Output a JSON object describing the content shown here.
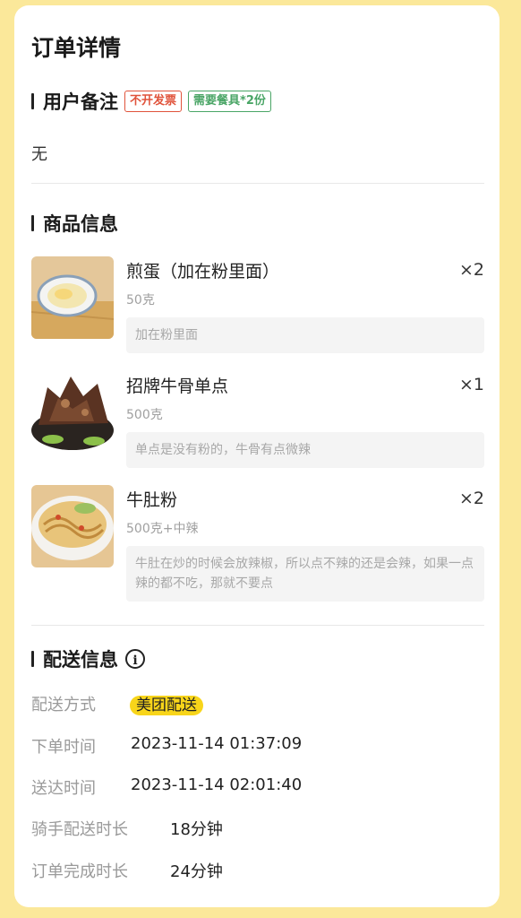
{
  "page": {
    "title": "订单详情"
  },
  "user_note": {
    "heading": "用户备注",
    "tags": [
      {
        "label": "不开发票",
        "color": "#e0533b"
      },
      {
        "label": "需要餐具*2份",
        "color": "#4aa566"
      }
    ],
    "text": "无"
  },
  "goods": {
    "heading": "商品信息",
    "items": [
      {
        "name": "煎蛋（加在粉里面）",
        "qty": "×2",
        "spec": "50克",
        "remark": "加在粉里面",
        "image": "fried-egg-dish"
      },
      {
        "name": "招牌牛骨单点",
        "qty": "×1",
        "spec": "500克",
        "remark": "单点是没有粉的，牛骨有点微辣",
        "image": "beef-bone-dish"
      },
      {
        "name": "牛肚粉",
        "qty": "×2",
        "spec": "500克+中辣",
        "remark": "牛肚在炒的时候会放辣椒，所以点不辣的还是会辣，如果一点辣的都不吃，那就不要点",
        "image": "tripe-noodle-bowl"
      }
    ]
  },
  "delivery": {
    "heading": "配送信息",
    "info_icon": "info-icon",
    "rows": [
      {
        "label": "配送方式",
        "value": "美团配送"
      },
      {
        "label": "下单时间",
        "value": "2023-11-14 01:37:09"
      },
      {
        "label": "送达时间",
        "value": "2023-11-14 02:01:40"
      },
      {
        "label": "骑手配送时长",
        "value": "18分钟"
      },
      {
        "label": "订单完成时长",
        "value": "24分钟"
      }
    ]
  },
  "colors": {
    "background": "#fbe89a",
    "badge": "#f8d51a",
    "card": "#ffffff"
  }
}
